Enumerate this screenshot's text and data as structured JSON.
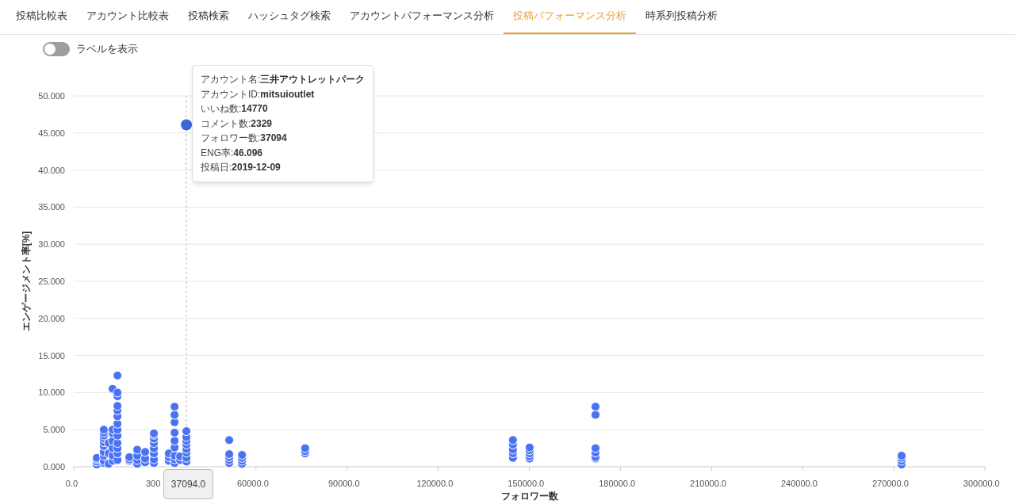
{
  "tabs": [
    {
      "label": "投稿比較表",
      "selected": false
    },
    {
      "label": "アカウント比較表",
      "selected": false
    },
    {
      "label": "投稿検索",
      "selected": false
    },
    {
      "label": "ハッシュタグ検索",
      "selected": false
    },
    {
      "label": "アカウントパフォーマンス分析",
      "selected": false
    },
    {
      "label": "投稿パフォーマンス分析",
      "selected": true
    },
    {
      "label": "時系列投稿分析",
      "selected": false
    }
  ],
  "label_toggle": {
    "label": "ラベルを表示",
    "on": false
  },
  "chart": {
    "tooltip": {
      "rows": [
        {
          "label": "アカウント名:",
          "value": "三井アウトレットパーク"
        },
        {
          "label": "アカウントID:",
          "value": "mitsuioutlet"
        },
        {
          "label": "いいね数:",
          "value": "14770"
        },
        {
          "label": "コメント数:",
          "value": "2329"
        },
        {
          "label": "フォロワー数:",
          "value": "37094"
        },
        {
          "label": "ENG率:",
          "value": "46.096"
        },
        {
          "label": "投稿日:",
          "value": "2019-12-09"
        }
      ]
    },
    "hover_x_label": "37094.0",
    "chart_data": {
      "type": "scatter",
      "xlabel": "フォロワー数",
      "ylabel": "エンゲージメント率[%]",
      "x": [
        7600,
        7600,
        7600,
        7600,
        9900,
        9900,
        9900,
        9900,
        9900,
        9900,
        9900,
        9900,
        9900,
        9900,
        11500,
        11500,
        11500,
        12800,
        12800,
        12800,
        12800,
        12800,
        12800,
        12800,
        14400,
        14400,
        14400,
        14400,
        14400,
        14400,
        14400,
        14400,
        14400,
        14400,
        14400,
        14400,
        14400,
        18300,
        18300,
        18300,
        20900,
        20900,
        20900,
        20900,
        23500,
        23500,
        23500,
        26400,
        26400,
        26400,
        26400,
        26400,
        26400,
        26400,
        26400,
        31300,
        31300,
        31300,
        33200,
        33200,
        33200,
        33200,
        33200,
        33200,
        33200,
        33200,
        33200,
        35000,
        35000,
        37094,
        37094,
        37094,
        37094,
        37094,
        37094,
        37094,
        37094,
        37094,
        51200,
        51200,
        51200,
        51200,
        51200,
        55400,
        55400,
        55400,
        55400,
        76200,
        76200,
        76200,
        144600,
        144600,
        144600,
        144600,
        144600,
        150100,
        150100,
        150100,
        150100,
        150100,
        171800,
        171800,
        171800,
        171800,
        171800,
        171800,
        272600,
        272600,
        272600,
        272600
      ],
      "series": [
        {
          "color": "#4a72f5",
          "values": [
            0.3,
            0.7,
            1.0,
            1.2,
            0.5,
            0.8,
            1.5,
            2.0,
            2.8,
            3.3,
            3.8,
            4.2,
            4.6,
            5.0,
            0.4,
            1.8,
            3.2,
            0.8,
            1.5,
            2.5,
            3.5,
            4.5,
            5.0,
            10.5,
            0.9,
            1.8,
            2.5,
            3.2,
            4.2,
            5.0,
            5.8,
            6.8,
            7.6,
            8.2,
            9.5,
            10.0,
            12.3,
            0.8,
            1.0,
            1.3,
            0.4,
            0.9,
            1.5,
            2.3,
            0.6,
            1.1,
            2.0,
            0.5,
            1.0,
            1.8,
            2.5,
            3.2,
            3.8,
            4.3,
            4.5,
            0.8,
            1.3,
            1.8,
            0.5,
            1.0,
            1.5,
            2.6,
            3.5,
            4.6,
            6.0,
            7.0,
            8.1,
            0.9,
            1.4,
            null,
            0.7,
            1.2,
            1.9,
            2.4,
            3.0,
            3.5,
            4.0,
            4.8,
            0.5,
            0.9,
            1.3,
            1.7,
            3.6,
            0.4,
            0.8,
            1.2,
            1.6,
            1.8,
            2.1,
            2.5,
            1.2,
            1.8,
            2.3,
            3.0,
            3.6,
            1.1,
            1.4,
            1.8,
            2.2,
            2.6,
            1.1,
            1.3,
            1.9,
            2.5,
            7.0,
            8.1,
            0.3,
            0.8,
            1.2,
            1.5
          ]
        },
        {
          "color": "#3d66d9",
          "values": [
            null,
            null,
            null,
            null,
            null,
            null,
            null,
            null,
            null,
            null,
            null,
            null,
            null,
            null,
            null,
            null,
            null,
            null,
            null,
            null,
            null,
            null,
            null,
            null,
            null,
            null,
            null,
            null,
            null,
            null,
            null,
            null,
            null,
            null,
            null,
            null,
            null,
            null,
            null,
            null,
            null,
            null,
            null,
            null,
            null,
            null,
            null,
            null,
            null,
            null,
            null,
            null,
            null,
            null,
            null,
            null,
            null,
            null,
            null,
            null,
            null,
            null,
            null,
            null,
            null,
            null,
            null,
            null,
            null,
            46.1,
            null,
            null,
            null,
            null,
            null,
            null,
            null,
            null,
            null,
            null,
            null,
            null,
            null,
            null,
            null,
            null,
            null,
            null,
            null,
            null,
            null,
            null,
            null,
            null,
            null,
            null,
            null,
            null,
            null,
            null,
            null,
            null,
            null,
            null,
            null,
            null,
            null,
            null,
            null,
            null
          ]
        }
      ],
      "grid": true,
      "xlim": [
        0,
        300000
      ],
      "ylim": [
        0,
        50
      ],
      "xticks": [
        {
          "value": 0,
          "label": "0.0"
        },
        {
          "value": 60000,
          "label": "60000.0"
        },
        {
          "value": 90000,
          "label": "90000.0"
        },
        {
          "value": 120000,
          "label": "120000.0"
        },
        {
          "value": 150000,
          "label": "150000.0"
        },
        {
          "value": 180000,
          "label": "180000.0"
        },
        {
          "value": 210000,
          "label": "210000.0"
        },
        {
          "value": 240000,
          "label": "240000.0"
        },
        {
          "value": 270000,
          "label": "270000.0"
        },
        {
          "value": 300000,
          "label": "300000.0"
        }
      ],
      "yticks": [
        {
          "value": 0,
          "label": "0.000"
        },
        {
          "value": 5,
          "label": "5.000"
        },
        {
          "value": 10,
          "label": "10.000"
        },
        {
          "value": 15,
          "label": "15.000"
        },
        {
          "value": 20,
          "label": "20.000"
        },
        {
          "value": 25,
          "label": "25.000"
        },
        {
          "value": 30,
          "label": "30.000"
        },
        {
          "value": 35,
          "label": "35.000"
        },
        {
          "value": 40,
          "label": "40.000"
        },
        {
          "value": 45,
          "label": "45.000"
        },
        {
          "value": 50,
          "label": "50.000"
        }
      ],
      "ref_lines": [
        {
          "axis": "x",
          "value": 37094
        }
      ]
    },
    "covered_tick_label": "300"
  }
}
